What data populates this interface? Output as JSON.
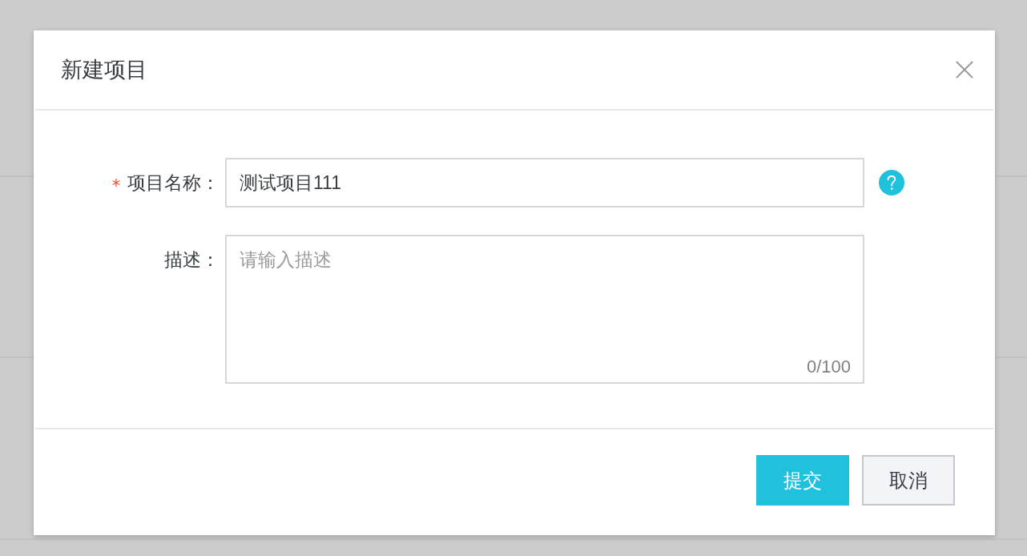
{
  "dialog": {
    "title": "新建项目",
    "fields": [
      {
        "kind": "input",
        "label": "项目名称：",
        "required": true,
        "value": "测试项目111",
        "help": true
      },
      {
        "kind": "textarea",
        "label": "描述：",
        "required": false,
        "placeholder": "请输入描述",
        "counter": "0/100"
      }
    ],
    "buttons": [
      {
        "label": "提交",
        "kind": "primary"
      },
      {
        "label": "取消",
        "kind": "secondary"
      }
    ]
  }
}
